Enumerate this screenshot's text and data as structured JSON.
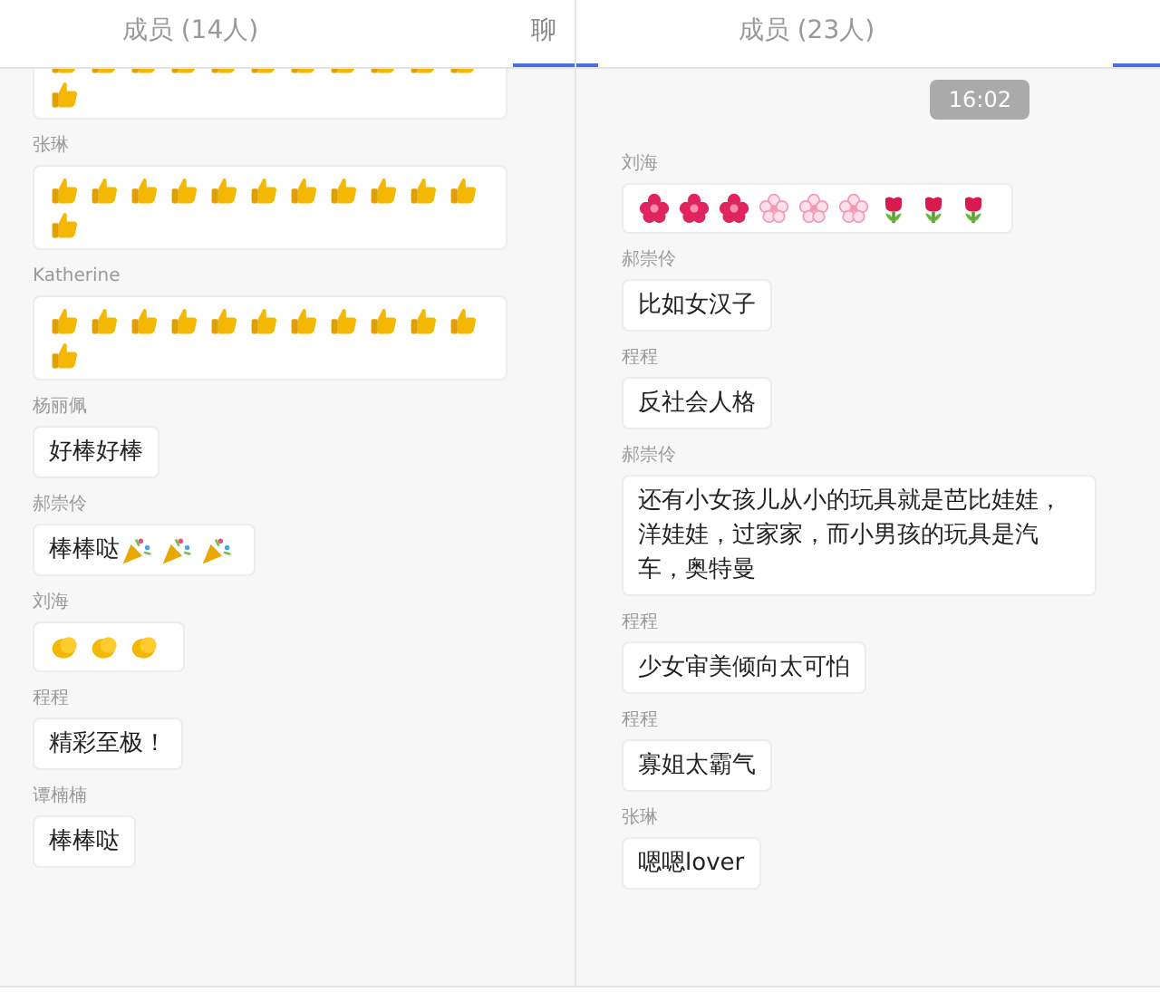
{
  "panels": [
    {
      "tabs": [
        {
          "label": "成员 (14人)",
          "selected": false
        },
        {
          "label": "聊",
          "selected": true
        }
      ],
      "messages": [
        {
          "parts": [
            {
              "kind": "thumb"
            },
            {
              "kind": "thumb"
            },
            {
              "kind": "thumb"
            },
            {
              "kind": "thumb"
            },
            {
              "kind": "thumb"
            },
            {
              "kind": "thumb"
            },
            {
              "kind": "thumb"
            },
            {
              "kind": "thumb"
            },
            {
              "kind": "thumb"
            },
            {
              "kind": "thumb"
            },
            {
              "kind": "thumb"
            },
            {
              "kind": "thumb"
            }
          ]
        },
        {
          "sender": "张琳",
          "parts": [
            {
              "kind": "thumb"
            },
            {
              "kind": "thumb"
            },
            {
              "kind": "thumb"
            },
            {
              "kind": "thumb"
            },
            {
              "kind": "thumb"
            },
            {
              "kind": "thumb"
            },
            {
              "kind": "thumb"
            },
            {
              "kind": "thumb"
            },
            {
              "kind": "thumb"
            },
            {
              "kind": "thumb"
            },
            {
              "kind": "thumb"
            },
            {
              "kind": "thumb"
            }
          ]
        },
        {
          "sender": "Katherine",
          "parts": [
            {
              "kind": "thumb"
            },
            {
              "kind": "thumb"
            },
            {
              "kind": "thumb"
            },
            {
              "kind": "thumb"
            },
            {
              "kind": "thumb"
            },
            {
              "kind": "thumb"
            },
            {
              "kind": "thumb"
            },
            {
              "kind": "thumb"
            },
            {
              "kind": "thumb"
            },
            {
              "kind": "thumb"
            },
            {
              "kind": "thumb"
            },
            {
              "kind": "thumb"
            }
          ]
        },
        {
          "sender": "杨丽佩",
          "parts": [
            {
              "kind": "text",
              "text": "好棒好棒"
            }
          ]
        },
        {
          "sender": "郝崇伶",
          "parts": [
            {
              "kind": "text",
              "text": "棒棒哒"
            },
            {
              "kind": "popper"
            },
            {
              "kind": "popper"
            },
            {
              "kind": "popper"
            }
          ]
        },
        {
          "sender": "刘海",
          "parts": [
            {
              "kind": "clap"
            },
            {
              "kind": "clap"
            },
            {
              "kind": "clap"
            }
          ]
        },
        {
          "sender": "程程",
          "parts": [
            {
              "kind": "text",
              "text": "精彩至极！"
            }
          ]
        },
        {
          "sender": "谭楠楠",
          "parts": [
            {
              "kind": "text",
              "text": "棒棒哒"
            }
          ]
        }
      ]
    },
    {
      "tabs": [
        {
          "selected": true
        },
        {
          "label": "成员 (23人)",
          "selected": false
        },
        {
          "selected": true
        }
      ],
      "messages": [
        {
          "time": "16:02"
        },
        {
          "sender": "刘海",
          "parts": [
            {
              "kind": "blossom"
            },
            {
              "kind": "blossom"
            },
            {
              "kind": "blossom"
            },
            {
              "kind": "flower"
            },
            {
              "kind": "flower"
            },
            {
              "kind": "flower"
            },
            {
              "kind": "tulip"
            },
            {
              "kind": "tulip"
            },
            {
              "kind": "tulip"
            }
          ]
        },
        {
          "sender": "郝崇伶",
          "parts": [
            {
              "kind": "text",
              "text": "比如女汉子"
            }
          ]
        },
        {
          "sender": "程程",
          "parts": [
            {
              "kind": "text",
              "text": "反社会人格"
            }
          ]
        },
        {
          "sender": "郝崇伶",
          "parts": [
            {
              "kind": "text",
              "text": "还有小女孩儿从小的玩具就是芭比娃娃，洋娃娃，过家家，而小男孩的玩具是汽车，奥特曼"
            }
          ]
        },
        {
          "sender": "程程",
          "parts": [
            {
              "kind": "text",
              "text": "少女审美倾向太可怕"
            }
          ]
        },
        {
          "sender": "程程",
          "parts": [
            {
              "kind": "text",
              "text": "寡姐太霸气"
            }
          ]
        },
        {
          "sender": "张琳",
          "parts": [
            {
              "kind": "text",
              "text": "嗯嗯lover"
            }
          ]
        }
      ]
    }
  ]
}
